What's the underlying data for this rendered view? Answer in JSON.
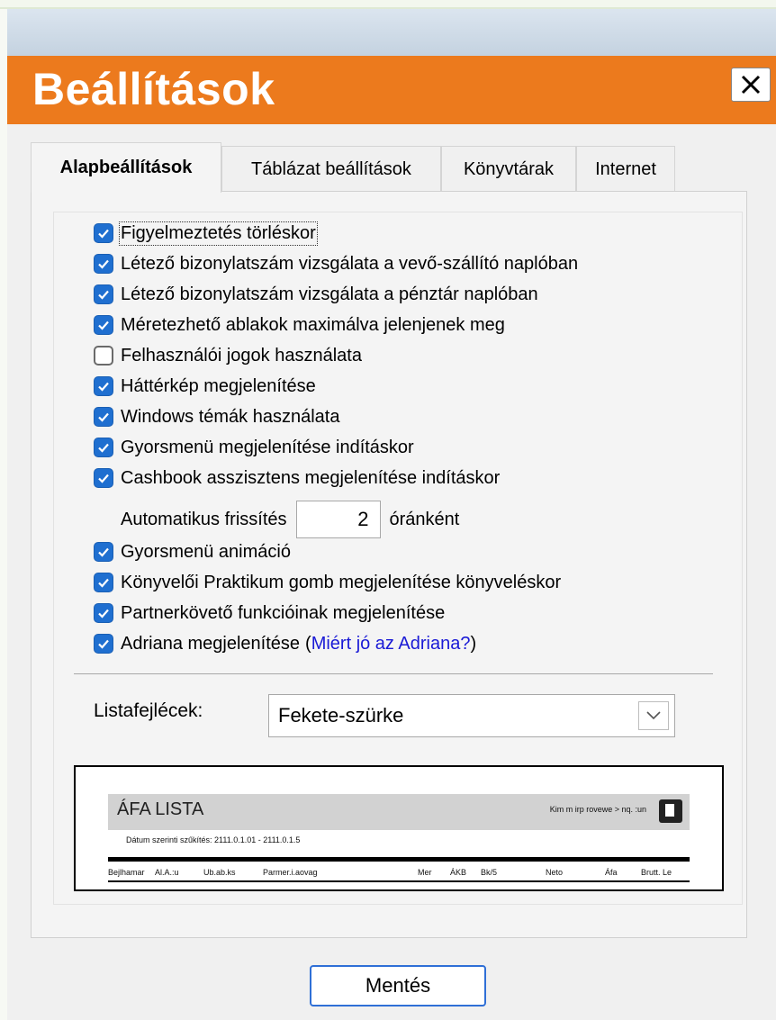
{
  "window": {
    "title": "Beállítások",
    "close_label": "✕"
  },
  "tabs": [
    {
      "label": "Alapbeállítások",
      "active": true
    },
    {
      "label": "Táblázat beállítások",
      "active": false
    },
    {
      "label": "Könyvtárak",
      "active": false
    },
    {
      "label": "Internet",
      "active": false
    }
  ],
  "options": [
    {
      "label": "Figyelmeztetés törléskor",
      "checked": true
    },
    {
      "label": "Létező bizonylatszám vizsgálata a vevő-szállító naplóban",
      "checked": true
    },
    {
      "label": "Létező bizonylatszám vizsgálata a pénztár naplóban",
      "checked": true
    },
    {
      "label": "Méretezhető ablakok maximálva jelenjenek meg",
      "checked": true
    },
    {
      "label": "Felhasználói jogok használata",
      "checked": false
    },
    {
      "label": "Háttérkép megjelenítése",
      "checked": true
    },
    {
      "label": "Windows témák használata",
      "checked": true
    },
    {
      "label": "Gyorsmenü megjelenítése indításkor",
      "checked": true
    },
    {
      "label": "Cashbook asszisztens megjelenítése indításkor",
      "checked": true
    },
    {
      "label": "Gyorsmenü animáció",
      "checked": true
    },
    {
      "label": "Könyvelői Praktikum gomb megjelenítése könyveléskor",
      "checked": true
    },
    {
      "label": "Partnerkövető funkcióinak megjelenítése",
      "checked": true
    },
    {
      "label": "Adriana megjelenítése",
      "checked": true
    }
  ],
  "adriana": {
    "open_paren": "(",
    "link": "Miért jó az Adriana?",
    "close_paren": " )"
  },
  "refresh": {
    "label": "Automatikus frissítés",
    "value": "2",
    "unit": "óránként"
  },
  "list_header": {
    "label": "Listafejlécek:",
    "selected": "Fekete-szürke"
  },
  "preview": {
    "title": "ÁFA LISTA",
    "right_text": "Kim m irp rovewe > nq. :un",
    "subtitle": "Dátum szerinti szűkítés: 2111.0.1.01 - 2111.0.1.5",
    "columns": [
      "Bejlhamar",
      "Al.A.:u",
      "Ub.ab.ks",
      "Parmer.i.aovag",
      "Mer",
      "ÁKB",
      "Bk/5",
      "Neto",
      "Áfa",
      "Brutt. Le"
    ]
  },
  "save_label": "Mentés",
  "colors": {
    "title_bar": "#ec7a1d",
    "checkbox": "#1f6fd0",
    "link": "#1a1ad6",
    "button_border": "#2f6fd6"
  }
}
